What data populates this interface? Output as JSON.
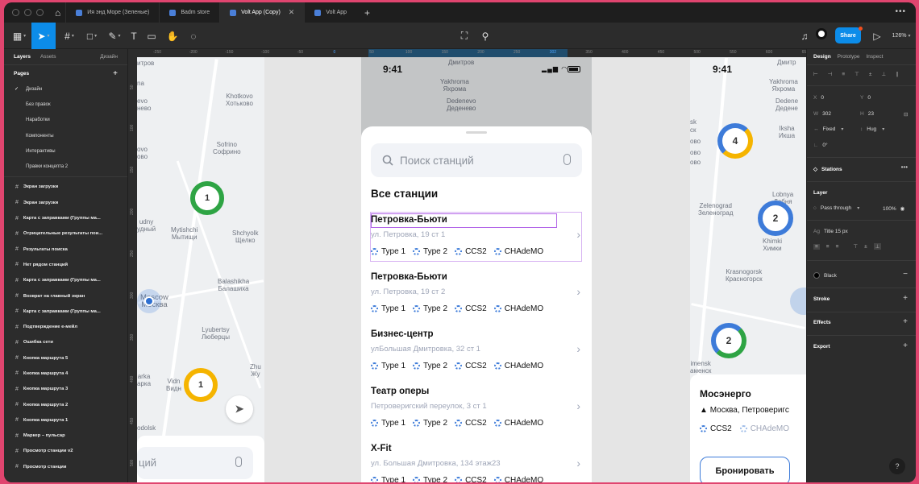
{
  "tabs": [
    {
      "label": "Ия энд Море (Зеленые)",
      "active": false
    },
    {
      "label": "Badm store",
      "active": false
    },
    {
      "label": "Volt App (Copy)",
      "active": true
    },
    {
      "label": "Volt App",
      "active": false
    }
  ],
  "toolbar": {
    "share_label": "Share",
    "zoom": "126%"
  },
  "left_panel": {
    "tabs": [
      "Layers",
      "Assets"
    ],
    "page_selector": "Дизайн",
    "pages_header": "Pages",
    "pages": [
      "Дизайн",
      "Без правок",
      "Наработки",
      "Компоненты",
      "Интерактивы",
      "Правки концепта 2"
    ],
    "layers": [
      "Экран загрузки",
      "Экран загрузки",
      "Карта с заправками (Группы ма...",
      "Отрицательные результаты пои...",
      "Результаты поиска",
      "Нет рядом станций",
      "Карта с заправками (Группы ма...",
      "Возврат на главный экран",
      "Карта с заправками (Группы ма...",
      "Подтверждение e-мейл",
      "Ошибка сети",
      "Кнопка маршрута 5",
      "Кнопка маршрута 4",
      "Кнопка маршрута 3",
      "Кнопка маршрута 2",
      "Кнопка маршрута 1",
      "Маркер – пульсар",
      "Просмотр станции v2",
      "Просмотр станции"
    ]
  },
  "ruler": {
    "ticks": [
      "-250",
      "-200",
      "-150",
      "-100",
      "-50",
      "0",
      "50",
      "100",
      "150",
      "200",
      "250",
      "302",
      "350",
      "400",
      "450",
      "500",
      "550",
      "600",
      "650"
    ],
    "left_ticks": [
      "50",
      "100",
      "150",
      "200",
      "250",
      "300",
      "350",
      "400",
      "450",
      "500"
    ]
  },
  "phone_a": {
    "labels": [
      {
        "text": "итров",
        "pos": "tl"
      },
      {
        "text": "Khotkovo\nХотьково"
      },
      {
        "text": "Sofrino\nСофрино"
      },
      {
        "text": "udny\nудный"
      },
      {
        "text": "Mytishchi\nМытищи"
      },
      {
        "text": "Shchyolk\nЩелко"
      },
      {
        "text": "Balashikha\nБалашиха"
      },
      {
        "text": "Moscow\nМосква"
      },
      {
        "text": "Lyubertsy\nЛюберцы"
      },
      {
        "text": "Vidn\nВидн"
      },
      {
        "text": "arka\nарка"
      },
      {
        "text": "Zhu\nЖу"
      },
      {
        "text": "na"
      },
      {
        "text": "evo"
      },
      {
        "text": "нево"
      },
      {
        "text": "ovo"
      },
      {
        "text": "ово"
      }
    ],
    "clusters": [
      "1",
      "1"
    ],
    "search_partial": "ций",
    "odolsk": "odolsk"
  },
  "phone_b": {
    "time": "9:41",
    "map_labels": [
      "Дмитров",
      "Yakhroma\nЯхрома",
      "Dedenevo\nДеденево"
    ],
    "search_placeholder": "Поиск станций",
    "section_title": "Все станции",
    "stations": [
      {
        "name": "Петровка-Бьюти",
        "address": "ул. Петровка, 19 ст 1",
        "tags": [
          "Type 1",
          "Type 2",
          "CCS2",
          "CHAdeMO"
        ]
      },
      {
        "name": "Петровка-Бьюти",
        "address": "ул. Петровка, 19 ст 2",
        "tags": [
          "Type 1",
          "Type 2",
          "CCS2",
          "CHAdeMO"
        ]
      },
      {
        "name": "Бизнес-центр",
        "address": "улБольшая Дмитровка, 32 ст 1",
        "tags": [
          "Type 1",
          "Type 2",
          "CCS2",
          "CHAdeMO"
        ]
      },
      {
        "name": "Театр оперы",
        "address": "Петроверигский переулок, 3 ст 1",
        "tags": [
          "Type 1",
          "Type 2",
          "CCS2",
          "CHAdeMO"
        ]
      },
      {
        "name": "X-Fit",
        "address": "ул. Большая Дмитровка, 134 этаж23",
        "tags": [
          "Type 1",
          "Type 2",
          "CCS2",
          "CHAdeMO"
        ]
      }
    ]
  },
  "phone_c": {
    "time": "9:41",
    "map_labels": [
      "Дмитр",
      "Yakhroma\nЯхрома",
      "Dedene\nДедене",
      "Ikshа\nИкша",
      "Lobnya\nЛобня",
      "Zelenograd\nЗеленоград",
      "Khimki\nХимки",
      "Krasnogorsk\nКрасногорск",
      "sk",
      "ск",
      "ово",
      "ово",
      "imensk\nаменск",
      "ово"
    ],
    "clusters": [
      "4",
      "2",
      "2"
    ],
    "card": {
      "name": "Мосэнерго",
      "address": "Москва, Петроверигс",
      "tags": [
        "CCS2",
        "CHAdeMO"
      ],
      "book_label": "Бронировать"
    }
  },
  "right_panel": {
    "tabs": [
      "Design",
      "Prototype",
      "Inspect"
    ],
    "x": "0",
    "y": "0",
    "w": "302",
    "h": "23",
    "w_mode": "Fixed",
    "h_mode": "Hug",
    "rotation": "0°",
    "component": "Stations",
    "layer_label": "Layer",
    "blend": "Pass through",
    "opacity": "100%",
    "text_style": "Title 15 px",
    "fill": "Black",
    "sections": [
      "Stroke",
      "Effects",
      "Export"
    ]
  }
}
